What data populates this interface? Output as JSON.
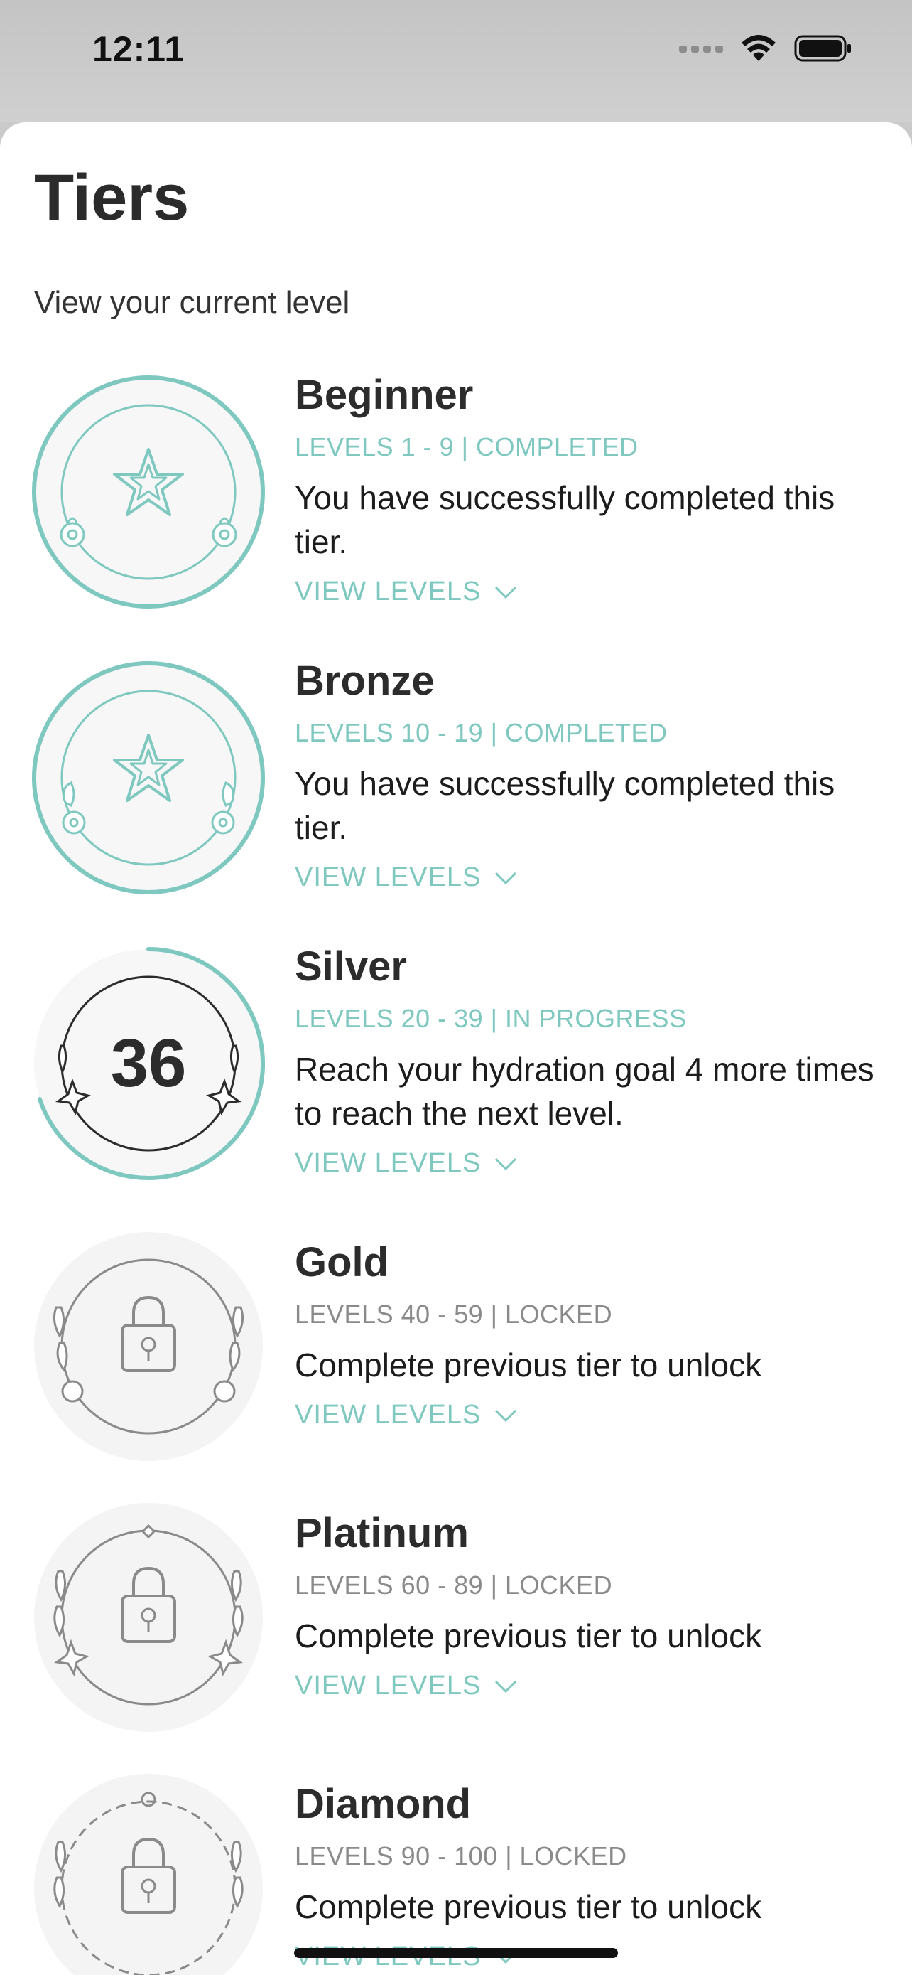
{
  "status_bar": {
    "time": "12:11",
    "icons": [
      "signal-icon",
      "wifi-icon",
      "battery-icon"
    ]
  },
  "header": {
    "title": "Tiers",
    "subtitle": "View your current level"
  },
  "colors": {
    "accent": "#7ec8c0",
    "locked": "#8a8a8a",
    "text": "#2c2c2c"
  },
  "tiers": [
    {
      "name": "Beginner",
      "meta": "LEVELS 1 - 9 | COMPLETED",
      "status": "completed",
      "description": "You have successfully completed this tier.",
      "view_label": "VIEW LEVELS"
    },
    {
      "name": "Bronze",
      "meta": "LEVELS 10 - 19 | COMPLETED",
      "status": "completed",
      "description": "You have successfully completed this tier.",
      "view_label": "VIEW LEVELS"
    },
    {
      "name": "Silver",
      "meta": "LEVELS 20 - 39 | IN PROGRESS",
      "status": "in-progress",
      "current_level": "36",
      "description": "Reach your hydration goal 4 more times to reach the next level.",
      "view_label": "VIEW LEVELS"
    },
    {
      "name": "Gold",
      "meta": "LEVELS 40 - 59 | LOCKED",
      "status": "locked",
      "description": "Complete previous tier to unlock",
      "view_label": "VIEW LEVELS"
    },
    {
      "name": "Platinum",
      "meta": "LEVELS 60 - 89 | LOCKED",
      "status": "locked",
      "description": "Complete previous tier to unlock",
      "view_label": "VIEW LEVELS"
    },
    {
      "name": "Diamond",
      "meta": "LEVELS 90 - 100 | LOCKED",
      "status": "locked",
      "description": "Complete previous tier to unlock",
      "view_label": "VIEW LEVELS"
    }
  ]
}
